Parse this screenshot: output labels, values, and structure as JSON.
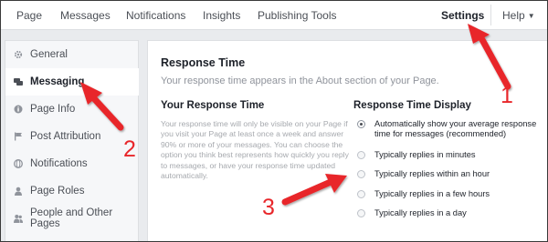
{
  "topnav": {
    "items": [
      "Page",
      "Messages",
      "Notifications",
      "Insights",
      "Publishing Tools"
    ],
    "settings": "Settings",
    "help": "Help"
  },
  "sidebar": {
    "items": [
      {
        "label": "General",
        "icon": "gear-icon"
      },
      {
        "label": "Messaging",
        "icon": "chat-bubbles-icon",
        "active": true
      },
      {
        "label": "Page Info",
        "icon": "info-icon"
      },
      {
        "label": "Post Attribution",
        "icon": "flag-icon"
      },
      {
        "label": "Notifications",
        "icon": "globe-icon"
      },
      {
        "label": "Page Roles",
        "icon": "person-icon"
      },
      {
        "label": "People and Other Pages",
        "icon": "people-icon"
      }
    ]
  },
  "main": {
    "title": "Response Time",
    "subtitle": "Your response time appears in the About section of your Page.",
    "your_response_time": {
      "title": "Your Response Time",
      "description": "Your response time will only be visible on your Page if you visit your Page at least once a week and answer 90% or more of your messages. You can choose the option you think best represents how quickly you reply to messages, or have your response time updated automatically."
    },
    "display": {
      "title": "Response Time Display",
      "options": [
        {
          "label": "Automatically show your average response time for messages (recommended)",
          "checked": true
        },
        {
          "label": "Typically replies in minutes",
          "checked": false
        },
        {
          "label": "Typically replies within an hour",
          "checked": false
        },
        {
          "label": "Typically replies in a few hours",
          "checked": false
        },
        {
          "label": "Typically replies in a day",
          "checked": false
        }
      ]
    }
  },
  "annotations": {
    "numbers": [
      "1",
      "2",
      "3"
    ],
    "arrow_color": "#e8262a"
  }
}
